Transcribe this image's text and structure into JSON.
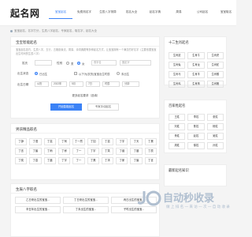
{
  "header": {
    "logo": "起名网",
    "nav": [
      "宝宝起名",
      "免费测名字",
      "生辰八字测算",
      "姓名大全",
      "起名字典",
      "周易",
      "公司起名",
      "宝宝取名"
    ],
    "active_index": 0
  },
  "notice": "宝宝起名，名字打分，生辰八字起名，专家起名，取名字，起名大全",
  "form": {
    "title": "宝宝智能起名",
    "desc": "宝宝起名技巧，生辰八字，五行，五格剖象法、周易、诗词典籍等多种起名方式，让宝宝拥有一个满意的好名字（主要依据宝宝出生时间的生辰八字）",
    "surname_label": "姓氏",
    "surname_placeholder": "",
    "gender_label": "性别",
    "gender_options": [
      "男",
      "女"
    ],
    "gender_selected": 1,
    "name_mode_label": "名字形式",
    "name_mode_options": [
      "双字名",
      "单字名"
    ],
    "name_fix_label": "固定字",
    "name_fix_placeholder": "",
    "birth_status_label": "出生状态",
    "birth_status_options": [
      "已出生",
      "未出生"
    ],
    "birth_check_text": "以下为(农历)宝宝出生时辰",
    "calendar_label": "出生日期",
    "calendar_type": "公历",
    "year": "2022年",
    "month": "5月",
    "day": "7日",
    "hour": "时辰",
    "minute": "分钟",
    "more_options": "更多起名要求（选填）",
    "submit": "开始智能起名",
    "expert": "专家手动起名"
  },
  "names_panel": {
    "title": "男孩精品取名",
    "rows": [
      [
        "丁静",
        "丁语",
        "丁嘉",
        "丁柯",
        "丁一然",
        "丁如",
        "丁嘉",
        "丁宇",
        "丁天",
        "丁昊"
      ],
      [
        "丁言",
        "丁宸",
        "丁雨",
        "丁睿",
        "丁一",
        "丁宇",
        "丁笑",
        "丁涵",
        "丁晨",
        "丁辰"
      ],
      [
        "丁奕",
        "丁嘉",
        "丁晨",
        "丁宇",
        "丁一",
        "丁昊",
        "丁沐",
        "丁家",
        "丁宸",
        "丁言"
      ]
    ]
  },
  "poems": {
    "title": "生辰八字取名",
    "items": [
      "乙日来出生的宝宝...",
      "丁日来出生的宝宝...",
      "丙日出生的宝宝...",
      "辛丑年出生的宝宝...",
      "丁未出生的宝宝...",
      "子时出生的宝宝..."
    ]
  },
  "side1": {
    "title": "十二生肖起名",
    "items": [
      "生肖鼠",
      "生肖牛",
      "生肖虎",
      "生肖兔",
      "生肖龙",
      "生肖蛇",
      "生肖马",
      "生肖羊",
      "生肖猴",
      "生肖鸡",
      "生肖狗",
      "生肖猪"
    ]
  },
  "side2": {
    "title": "百家姓起名",
    "items": [
      "王姓",
      "李姓",
      "张姓",
      "刘姓",
      "陈姓",
      "杨姓",
      "黄姓",
      "赵姓",
      "吴姓",
      "周姓",
      "徐姓",
      "孙姓"
    ]
  },
  "side3": {
    "title": "最新起名知识"
  },
  "watermark": {
    "title": "自动秒收录",
    "subtitle": "做 上 排 名 一 来 访 一 次 一 自 动 收 录"
  }
}
